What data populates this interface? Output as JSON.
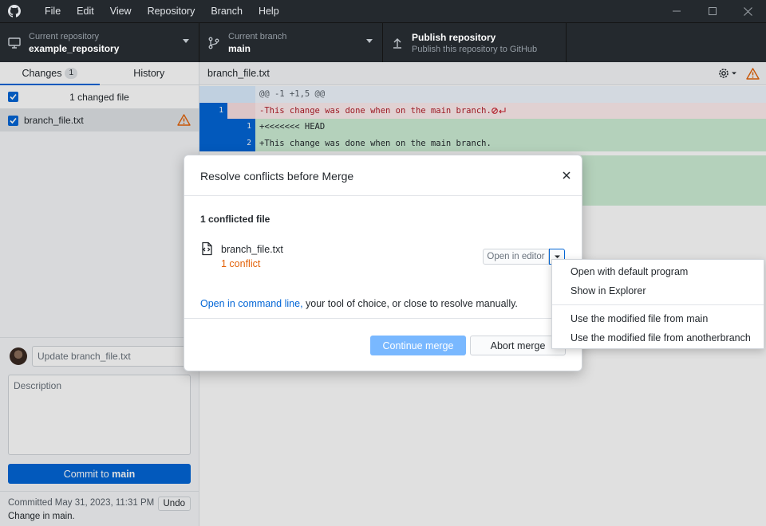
{
  "menu": [
    "File",
    "Edit",
    "View",
    "Repository",
    "Branch",
    "Help"
  ],
  "toolbar": {
    "repo_label": "Current repository",
    "repo_value": "example_repository",
    "branch_label": "Current branch",
    "branch_value": "main",
    "publish_title": "Publish repository",
    "publish_sub": "Publish this repository to GitHub"
  },
  "sidebar": {
    "tab_changes": "Changes",
    "tab_changes_count": "1",
    "tab_history": "History",
    "changed_files_header": "1 changed file",
    "file_name": "branch_file.txt"
  },
  "commit": {
    "summary_placeholder": "Update branch_file.txt",
    "description_placeholder": "Description",
    "button_prefix": "Commit to ",
    "button_branch": "main",
    "last_commit_time": "Committed May 31, 2023, 11:31 PM",
    "last_commit_msg": "Change in main.",
    "undo_label": "Undo"
  },
  "diff": {
    "file_name": "branch_file.txt",
    "lines": [
      {
        "kind": "hunk",
        "old": "",
        "new": "",
        "text": "@@ -1 +1,5 @@"
      },
      {
        "kind": "del",
        "old": "1",
        "new": "",
        "text": "-This change was done when on the main branch."
      },
      {
        "kind": "add",
        "old": "",
        "new": "1",
        "text": "+<<<<<<< HEAD"
      },
      {
        "kind": "add",
        "old": "",
        "new": "2",
        "text": "+This change was done when on the main branch."
      }
    ]
  },
  "dialog": {
    "title": "Resolve conflicts before Merge",
    "conflicted_count": "1 conflicted file",
    "file_name": "branch_file.txt",
    "conflict_count": "1 conflict",
    "open_editor": "Open in editor",
    "help_link": "Open in command line,",
    "help_rest": " your tool of choice, or close to resolve manually.",
    "continue_label": "Continue merge",
    "abort_label": "Abort merge"
  },
  "context_menu": {
    "items": [
      "Open with default program",
      "Show in Explorer",
      "Use the modified file from main",
      "Use the modified file from anotherbranch"
    ]
  },
  "colors": {
    "accent": "#0366d6",
    "warning": "#e36209",
    "dark": "#24292e"
  }
}
